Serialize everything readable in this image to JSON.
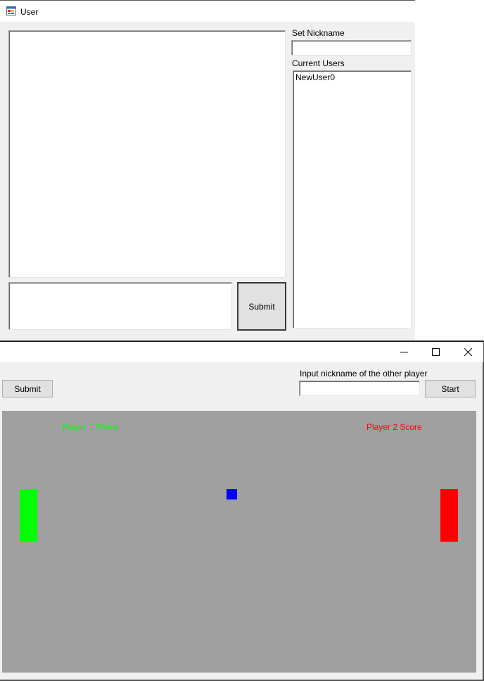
{
  "user_window": {
    "title": "User",
    "nickname_label": "Set Nickname",
    "nickname_value": "",
    "current_users_label": "Current Users",
    "users": [
      "NewUser0"
    ],
    "message_value": "",
    "submit_label": "Submit"
  },
  "game_window": {
    "submit_label": "Submit",
    "other_player_label": "Input nickname of the other player",
    "other_player_value": "",
    "start_label": "Start",
    "player1_score_label": "Player 1 Score",
    "player2_score_label": "Player 2 Score",
    "colors": {
      "player1": "#00ff00",
      "player2": "#ff0000",
      "ball": "#0000ff",
      "field": "#a0a0a0"
    },
    "caption_icons": [
      "minimize-icon",
      "maximize-icon",
      "close-icon"
    ]
  }
}
